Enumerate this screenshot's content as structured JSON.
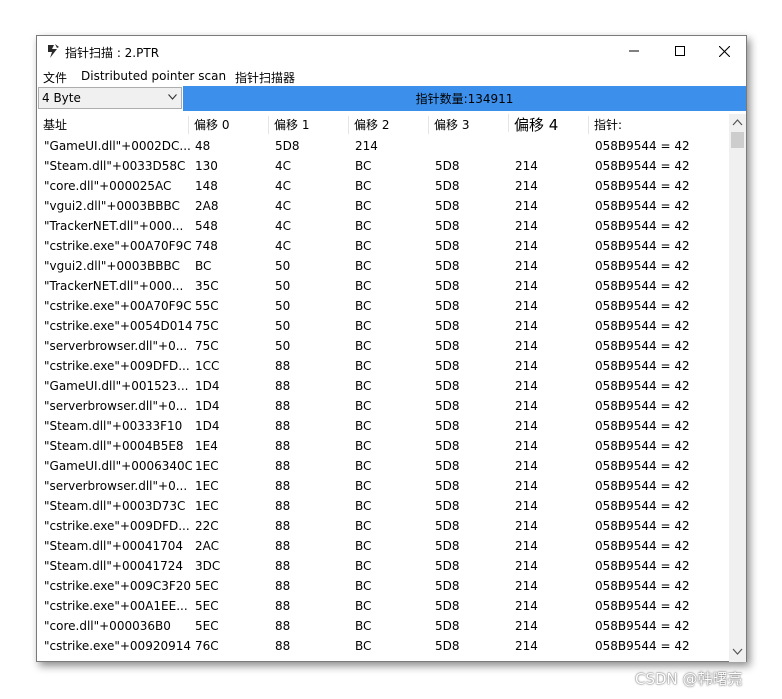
{
  "window": {
    "title": "指针扫描 : 2.PTR",
    "minimize_glyph": "—",
    "maximize_glyph": "☐",
    "close_glyph": "✕"
  },
  "menu": {
    "items": [
      "文件",
      "Distributed pointer scan",
      "指针扫描器"
    ]
  },
  "toolbar": {
    "type_select": "4 Byte",
    "pointer_count_label": "指针数量:134911",
    "banner_color": "#3c8fea"
  },
  "table": {
    "headers": [
      "基址",
      "偏移 0",
      "偏移 1",
      "偏移 2",
      "偏移 3",
      "偏移 4",
      "指针:"
    ],
    "rows": [
      [
        "\"GameUI.dll\"+0002DC...",
        "48",
        "5D8",
        "214",
        "",
        "",
        "058B9544 = 42"
      ],
      [
        "\"Steam.dll\"+0033D58C",
        "130",
        "4C",
        "BC",
        "5D8",
        "214",
        "058B9544 = 42"
      ],
      [
        "\"core.dll\"+000025AC",
        "148",
        "4C",
        "BC",
        "5D8",
        "214",
        "058B9544 = 42"
      ],
      [
        "\"vgui2.dll\"+0003BBBC",
        "2A8",
        "4C",
        "BC",
        "5D8",
        "214",
        "058B9544 = 42"
      ],
      [
        "\"TrackerNET.dll\"+000...",
        "548",
        "4C",
        "BC",
        "5D8",
        "214",
        "058B9544 = 42"
      ],
      [
        "\"cstrike.exe\"+00A70F9C",
        "748",
        "4C",
        "BC",
        "5D8",
        "214",
        "058B9544 = 42"
      ],
      [
        "\"vgui2.dll\"+0003BBBC",
        "BC",
        "50",
        "BC",
        "5D8",
        "214",
        "058B9544 = 42"
      ],
      [
        "\"TrackerNET.dll\"+000...",
        "35C",
        "50",
        "BC",
        "5D8",
        "214",
        "058B9544 = 42"
      ],
      [
        "\"cstrike.exe\"+00A70F9C",
        "55C",
        "50",
        "BC",
        "5D8",
        "214",
        "058B9544 = 42"
      ],
      [
        "\"cstrike.exe\"+0054D014",
        "75C",
        "50",
        "BC",
        "5D8",
        "214",
        "058B9544 = 42"
      ],
      [
        "\"serverbrowser.dll\"+0...",
        "75C",
        "50",
        "BC",
        "5D8",
        "214",
        "058B9544 = 42"
      ],
      [
        "\"cstrike.exe\"+009DFD...",
        "1CC",
        "88",
        "BC",
        "5D8",
        "214",
        "058B9544 = 42"
      ],
      [
        "\"GameUI.dll\"+001523...",
        "1D4",
        "88",
        "BC",
        "5D8",
        "214",
        "058B9544 = 42"
      ],
      [
        "\"serverbrowser.dll\"+0...",
        "1D4",
        "88",
        "BC",
        "5D8",
        "214",
        "058B9544 = 42"
      ],
      [
        "\"Steam.dll\"+00333F10",
        "1D4",
        "88",
        "BC",
        "5D8",
        "214",
        "058B9544 = 42"
      ],
      [
        "\"Steam.dll\"+0004B5E8",
        "1E4",
        "88",
        "BC",
        "5D8",
        "214",
        "058B9544 = 42"
      ],
      [
        "\"GameUI.dll\"+0006340C",
        "1EC",
        "88",
        "BC",
        "5D8",
        "214",
        "058B9544 = 42"
      ],
      [
        "\"serverbrowser.dll\"+0...",
        "1EC",
        "88",
        "BC",
        "5D8",
        "214",
        "058B9544 = 42"
      ],
      [
        "\"Steam.dll\"+0003D73C",
        "1EC",
        "88",
        "BC",
        "5D8",
        "214",
        "058B9544 = 42"
      ],
      [
        "\"cstrike.exe\"+009DFD...",
        "22C",
        "88",
        "BC",
        "5D8",
        "214",
        "058B9544 = 42"
      ],
      [
        "\"Steam.dll\"+00041704",
        "2AC",
        "88",
        "BC",
        "5D8",
        "214",
        "058B9544 = 42"
      ],
      [
        "\"Steam.dll\"+00041724",
        "3DC",
        "88",
        "BC",
        "5D8",
        "214",
        "058B9544 = 42"
      ],
      [
        "\"cstrike.exe\"+009C3F20",
        "5EC",
        "88",
        "BC",
        "5D8",
        "214",
        "058B9544 = 42"
      ],
      [
        "\"cstrike.exe\"+00A1EE...",
        "5EC",
        "88",
        "BC",
        "5D8",
        "214",
        "058B9544 = 42"
      ],
      [
        "\"core.dll\"+000036B0",
        "5EC",
        "88",
        "BC",
        "5D8",
        "214",
        "058B9544 = 42"
      ],
      [
        "\"cstrike.exe\"+00920914",
        "76C",
        "88",
        "BC",
        "5D8",
        "214",
        "058B9544 = 42"
      ]
    ]
  },
  "watermark": "CSDN @韩曙亮"
}
